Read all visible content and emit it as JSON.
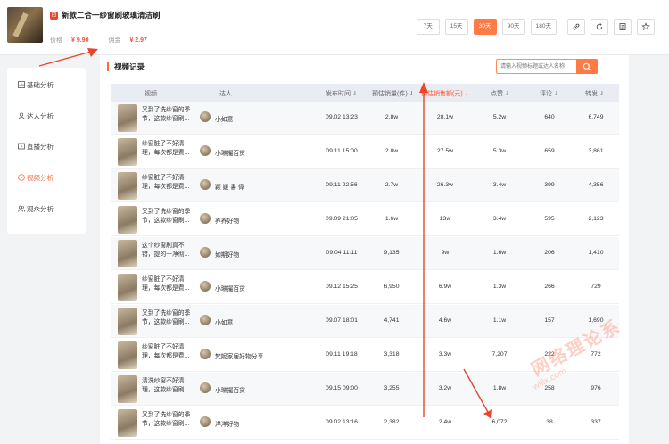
{
  "product": {
    "badge": "团",
    "title": "新款二合一纱窗刷玻璃清洁刷",
    "price_label": "价格",
    "price": "¥ 9.90",
    "commission_label": "佣金",
    "commission": "¥ 2.97"
  },
  "range_buttons": [
    "7天",
    "15天",
    "30天",
    "90天",
    "180天"
  ],
  "active_range": "30天",
  "icon_buttons": [
    "link-icon",
    "refresh-icon",
    "qrcode-icon",
    "star-icon"
  ],
  "sidebar": {
    "items": [
      {
        "label": "基础分析",
        "icon": "chart-icon"
      },
      {
        "label": "达人分析",
        "icon": "user-icon"
      },
      {
        "label": "直播分析",
        "icon": "live-icon"
      },
      {
        "label": "视频分析",
        "icon": "play-icon"
      },
      {
        "label": "观众分析",
        "icon": "audience-icon"
      }
    ],
    "active": "视频分析"
  },
  "section_title": "视频记录",
  "search": {
    "placeholder": "请输入视频标题或达人名称"
  },
  "table": {
    "headers": {
      "video": "视频",
      "author": "达人",
      "time": "发布时间",
      "sales": "预估销量(件)",
      "gmv": "预估销售额(元)",
      "likes": "点赞",
      "comments": "评论",
      "shares": "转发"
    },
    "rows": [
      {
        "desc": "又到了洗纱窗的季节，这款纱窗刷...",
        "author": "小如意",
        "time": "09.02 13:23",
        "sales": "2.8w",
        "gmv": "28.1w",
        "likes": "5.2w",
        "comments": "640",
        "shares": "6,749"
      },
      {
        "desc": "纱窗脏了不好清理，每次都是费...",
        "author": "小琳撮百货",
        "time": "09.11 15:00",
        "sales": "2.8w",
        "gmv": "27.5w",
        "likes": "5.3w",
        "comments": "659",
        "shares": "3,861"
      },
      {
        "desc": "纱窗脏了不好清理，每次都是费...",
        "author": "颖 媛 書 偉",
        "time": "09.11 22:56",
        "sales": "2.7w",
        "gmv": "26.3w",
        "likes": "3.4w",
        "comments": "399",
        "shares": "4,356"
      },
      {
        "desc": "又到了洗纱窗的季节，这款纱窗刷...",
        "author": "养养好物",
        "time": "09.09 21:05",
        "sales": "1.6w",
        "gmv": "13w",
        "likes": "3.4w",
        "comments": "595",
        "shares": "2,123"
      },
      {
        "desc": "这个纱窗刷真不错，提的干净彻...",
        "author": "如期好物",
        "time": "09.04 11:11",
        "sales": "9,135",
        "gmv": "9w",
        "likes": "1.6w",
        "comments": "206",
        "shares": "1,410"
      },
      {
        "desc": "纱窗脏了不好清理，每次都是费...",
        "author": "小琳撮百货",
        "time": "09.12 15:25",
        "sales": "6,950",
        "gmv": "6.9w",
        "likes": "1.3w",
        "comments": "266",
        "shares": "729"
      },
      {
        "desc": "又到了洗纱窗的季节，这款纱窗刷...",
        "author": "小如意",
        "time": "09.07 18:01",
        "sales": "4,741",
        "gmv": "4.6w",
        "likes": "1.1w",
        "comments": "157",
        "shares": "1,690"
      },
      {
        "desc": "纱窗脏了不好清理，每次都是费...",
        "author": "梵妮家居好物分享",
        "time": "09.11 19:18",
        "sales": "3,318",
        "gmv": "3.3w",
        "likes": "7,207",
        "comments": "222",
        "shares": "772"
      },
      {
        "desc": "清洗纱窗不好清理，这款纱窗刷...",
        "author": "小琳撮百货",
        "time": "09.15 09:00",
        "sales": "3,255",
        "gmv": "3.2w",
        "likes": "1.8w",
        "comments": "258",
        "shares": "976"
      },
      {
        "desc": "又到了洗纱窗的季节，这款纱窗刷...",
        "author": "洋洋好物",
        "time": "09.02 13:16",
        "sales": "2,382",
        "gmv": "2.4w",
        "likes": "6,072",
        "comments": "38",
        "shares": "337"
      }
    ]
  },
  "watermark": {
    "main": "网络理论系",
    "sub": "wlllx.com"
  },
  "colors": {
    "accent": "#ff7a45",
    "price": "#f05a3a",
    "arrow": "#e8452e"
  }
}
